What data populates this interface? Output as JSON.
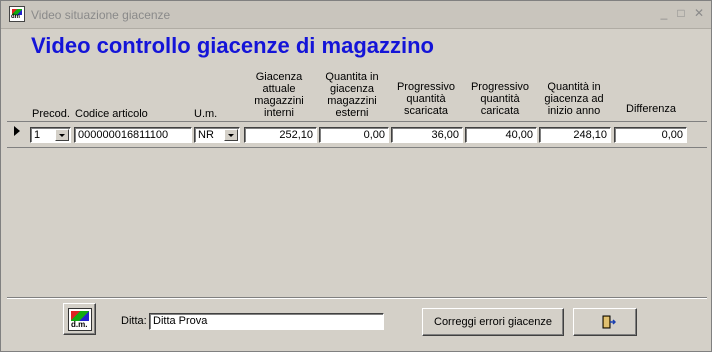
{
  "window": {
    "title": "Video situazione giacenze"
  },
  "heading": "Video controllo giacenze di magazzino",
  "columns": {
    "precod": "Precod.",
    "codice": "Codice articolo",
    "um": "U.m.",
    "giac_int": "Giacenza attuale magazzini interni",
    "qta_est": "Quantita in giacenza magazzini esterni",
    "prog_scar": "Progressivo quantità scaricata",
    "prog_car": "Progressivo quantità caricata",
    "qta_inizio": "Quantità in giacenza ad inizio anno",
    "differenza": "Differenza"
  },
  "row": {
    "precod": "1",
    "codice": "000000016811100",
    "um": "NR",
    "giac_int": "252,10",
    "qta_est": "0,00",
    "prog_scar": "36,00",
    "prog_car": "40,00",
    "qta_inizio": "248,10",
    "differenza": "0,00"
  },
  "footer": {
    "dm_label": "d.m.",
    "ditta_label": "Ditta:",
    "ditta_value": "Ditta Prova",
    "correggi_label": "Correggi errori giacenze",
    "exit_icon": "exit-door-icon"
  },
  "colors": {
    "heading": "#1414d8",
    "background": "#d4d0c8"
  }
}
